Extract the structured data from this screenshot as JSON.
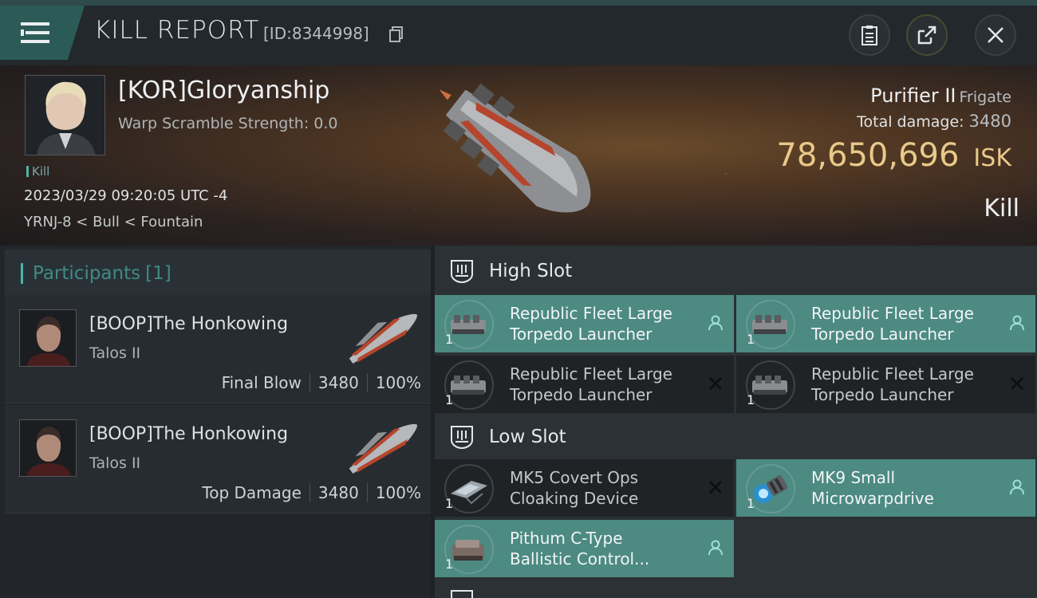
{
  "header": {
    "title": "KILL REPORT",
    "report_id": "[ID:8344998]",
    "icons": [
      "menu-icon",
      "copy-icon",
      "clipboard-icon",
      "share-icon",
      "close-icon"
    ]
  },
  "victim": {
    "name": "[KOR]Gloryanship",
    "warp_scramble": "Warp Scramble Strength: 0.0",
    "tag": "Kill",
    "datetime": "2023/03/29 09:20:05 UTC -4",
    "location": "YRNJ-8 < Bull < Fountain",
    "ship": "Purifier II",
    "ship_class": "Frigate",
    "total_damage_label": "Total damage:",
    "total_damage": "3480",
    "isk_value": "78,650,696",
    "isk_unit": "ISK",
    "result": "Kill"
  },
  "participants": {
    "title": "Participants",
    "count": "[1]",
    "rows": [
      {
        "name": "[BOOP]The Honkowing",
        "ship": "Talos II",
        "role": "Final Blow",
        "damage": "3480",
        "percent": "100%"
      },
      {
        "name": "[BOOP]The Honkowing",
        "ship": "Talos II",
        "role": "Top Damage",
        "damage": "3480",
        "percent": "100%"
      }
    ]
  },
  "slots": {
    "high": {
      "label": "High Slot",
      "modules": [
        {
          "line1": "Republic Fleet Large",
          "line2": "Torpedo Launcher",
          "qty": "1",
          "state": "pilot"
        },
        {
          "line1": "Republic Fleet Large",
          "line2": "Torpedo Launcher",
          "qty": "1",
          "state": "pilot"
        },
        {
          "line1": "Republic Fleet Large",
          "line2": "Torpedo Launcher",
          "qty": "1",
          "state": "destroyed"
        },
        {
          "line1": "Republic Fleet Large",
          "line2": "Torpedo Launcher",
          "qty": "1",
          "state": "destroyed"
        }
      ]
    },
    "low": {
      "label": "Low Slot",
      "modules": [
        {
          "line1": "MK5 Covert Ops",
          "line2": "Cloaking Device",
          "qty": "1",
          "state": "destroyed"
        },
        {
          "line1": "MK9 Small",
          "line2": "Microwarpdrive",
          "qty": "1",
          "state": "pilot"
        },
        {
          "line1": "Pithum C-Type",
          "line2": "Ballistic Control...",
          "qty": "1",
          "state": "pilot"
        }
      ]
    }
  },
  "colors": {
    "accent": "#4db3a6",
    "active_module": "#4c8a82",
    "isk": "#e9c98a"
  }
}
